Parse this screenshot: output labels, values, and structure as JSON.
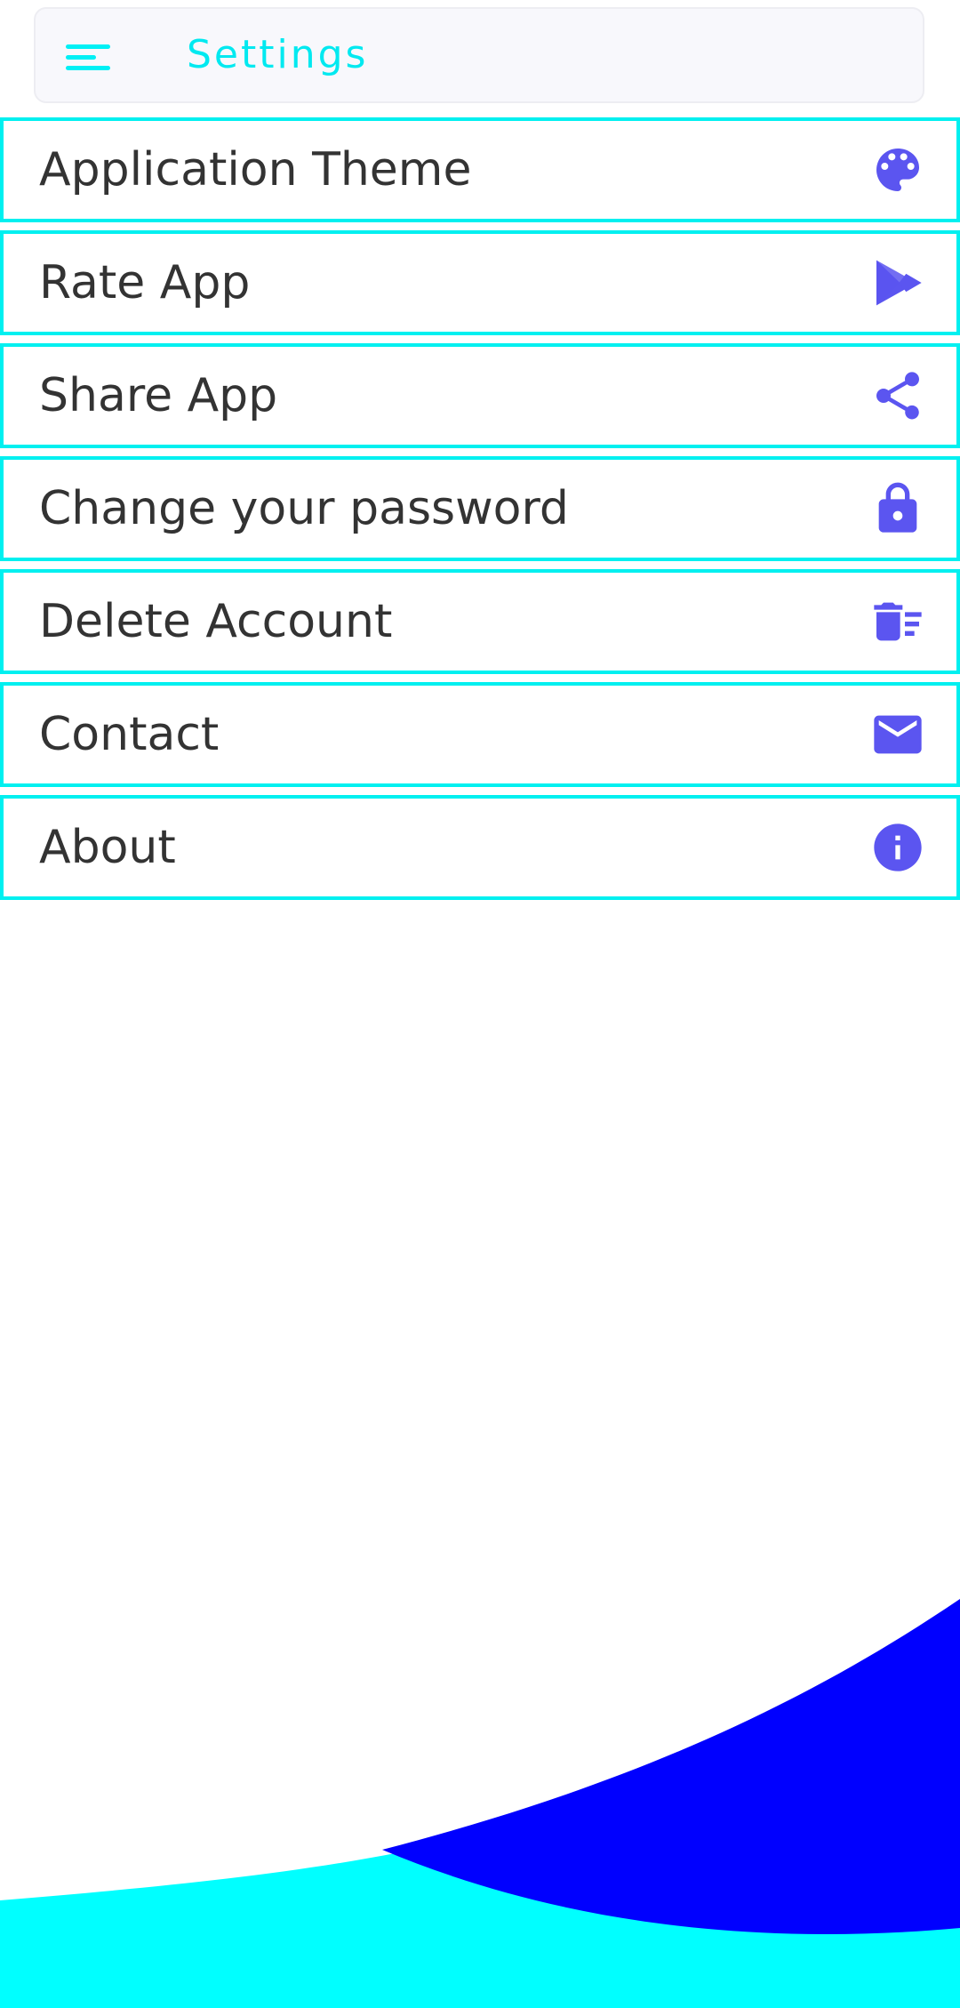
{
  "appbar": {
    "title": "Settings",
    "menu_icon": "hamburger-menu-icon"
  },
  "colors": {
    "accent": "#00f0f5",
    "icon": "#5b55f0",
    "wave_cyan": "#00ffff",
    "wave_blue": "#0000ff",
    "row_border": "#00f0f0",
    "text": "#333333"
  },
  "settings": {
    "items": [
      {
        "label": "Application Theme",
        "icon": "palette-icon"
      },
      {
        "label": "Rate App",
        "icon": "play-store-icon"
      },
      {
        "label": "Share App",
        "icon": "share-icon"
      },
      {
        "label": "Change your password",
        "icon": "lock-icon"
      },
      {
        "label": "Delete Account",
        "icon": "delete-sweep-icon"
      },
      {
        "label": "Contact",
        "icon": "mail-icon"
      },
      {
        "label": "About",
        "icon": "info-icon"
      }
    ]
  }
}
